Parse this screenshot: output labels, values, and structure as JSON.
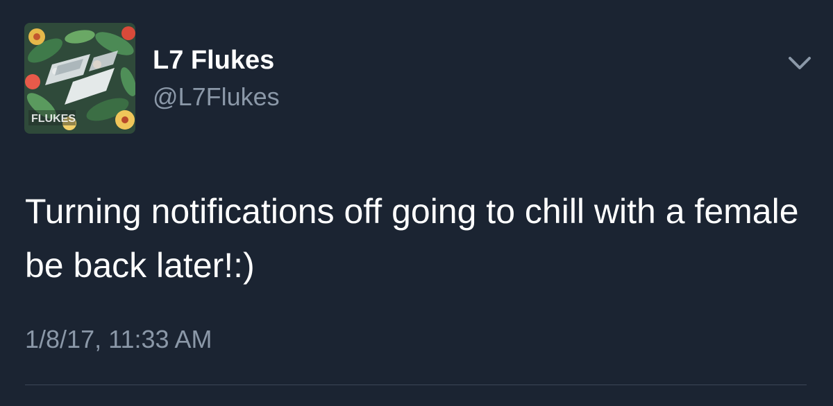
{
  "tweet": {
    "display_name": "L7 Flukes",
    "handle": "@L7Flukes",
    "text": "Turning notifications off going to chill with a female be back later!:)",
    "timestamp": "1/8/17, 11:33 AM",
    "avatar_logo_text": "FLUKES"
  },
  "icons": {
    "avatar": "profile-avatar-floral-logo",
    "menu": "chevron-down-icon"
  },
  "colors": {
    "background": "#1b2432",
    "primary_text": "#ffffff",
    "secondary_text": "#8b98a8",
    "divider": "#3d4757"
  }
}
